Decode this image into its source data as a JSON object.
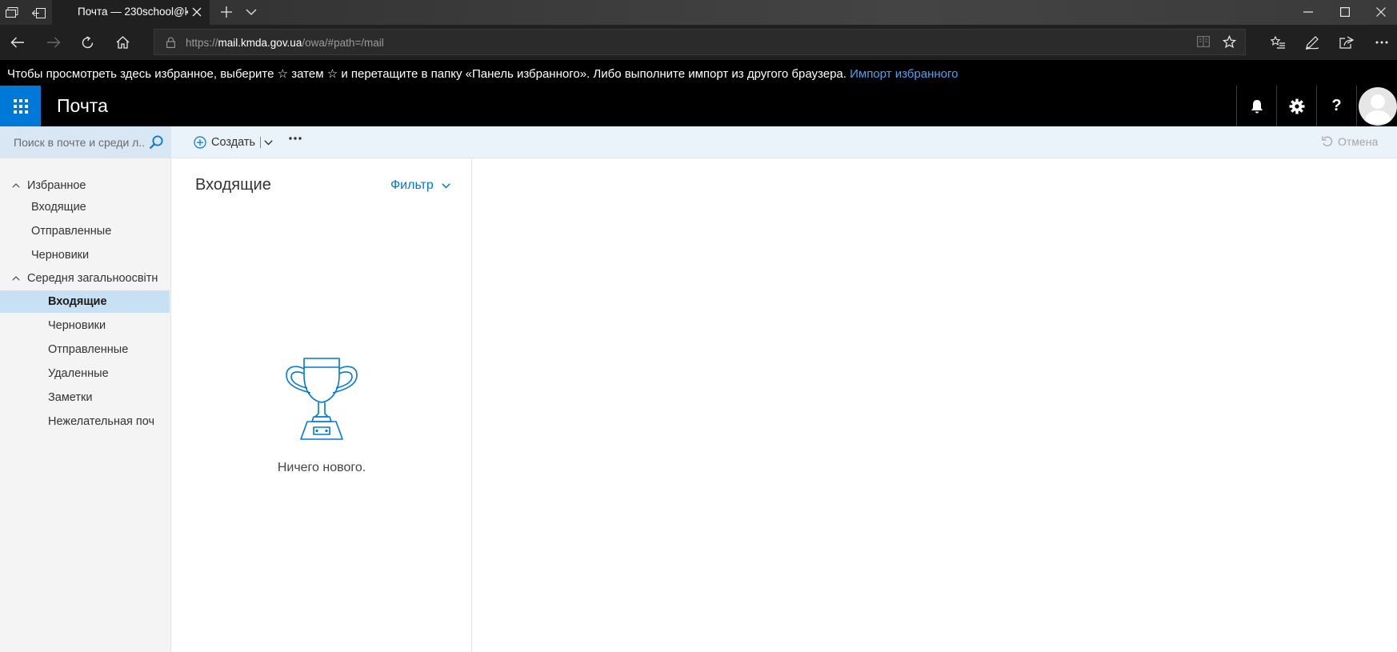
{
  "browser": {
    "tab_title": "Почта — 230school@k",
    "url_scheme": "https://",
    "url_domain": "mail.kmda.gov.ua",
    "url_path": "/owa/#path=/mail"
  },
  "favorites_bar": {
    "text_before": "Чтобы просмотреть здесь избранное, выберите ",
    "star1": "☆",
    "text_middle": " затем ",
    "star2": "☆",
    "text_after": " и перетащите в папку «Панель избранного». Либо выполните импорт из другого браузера. ",
    "import_link": "Импорт избранного"
  },
  "header": {
    "app_title": "Почта",
    "help_label": "?"
  },
  "command_bar": {
    "search_placeholder": "Поиск в почте и среди л...",
    "create_label": "Создать",
    "undo_label": "Отмена"
  },
  "sidebar": {
    "favorites_group": "Избранное",
    "favorites": [
      "Входящие",
      "Отправленные",
      "Черновики"
    ],
    "mailbox_group": "Середня загальноосвітн",
    "folders": [
      "Входящие",
      "Черновики",
      "Отправленные",
      "Удаленные",
      "Заметки",
      "Нежелательная поч"
    ],
    "selected_folder": "Входящие"
  },
  "message_list": {
    "title": "Входящие",
    "filter_label": "Фильтр",
    "empty_text": "Ничего нового."
  },
  "colors": {
    "accent": "#0078d7",
    "selected_folder_bg": "#c7e0f4",
    "command_bar_bg": "#eaf2fa",
    "header_bg": "#000000"
  },
  "icons": [
    "tab-list-icon",
    "set-aside-tabs-icon",
    "close-icon",
    "new-tab-icon",
    "chevron-down-icon",
    "minimize-icon",
    "maximize-icon",
    "back-icon",
    "forward-icon",
    "refresh-icon",
    "home-icon",
    "lock-icon",
    "reading-view-icon",
    "favorite-star-icon",
    "favorites-list-icon",
    "pen-icon",
    "share-icon",
    "more-icon",
    "waffle-icon",
    "bell-icon",
    "gear-icon",
    "help-icon",
    "avatar-icon",
    "search-icon",
    "plus-circle-icon",
    "undo-icon",
    "trophy-icon"
  ]
}
